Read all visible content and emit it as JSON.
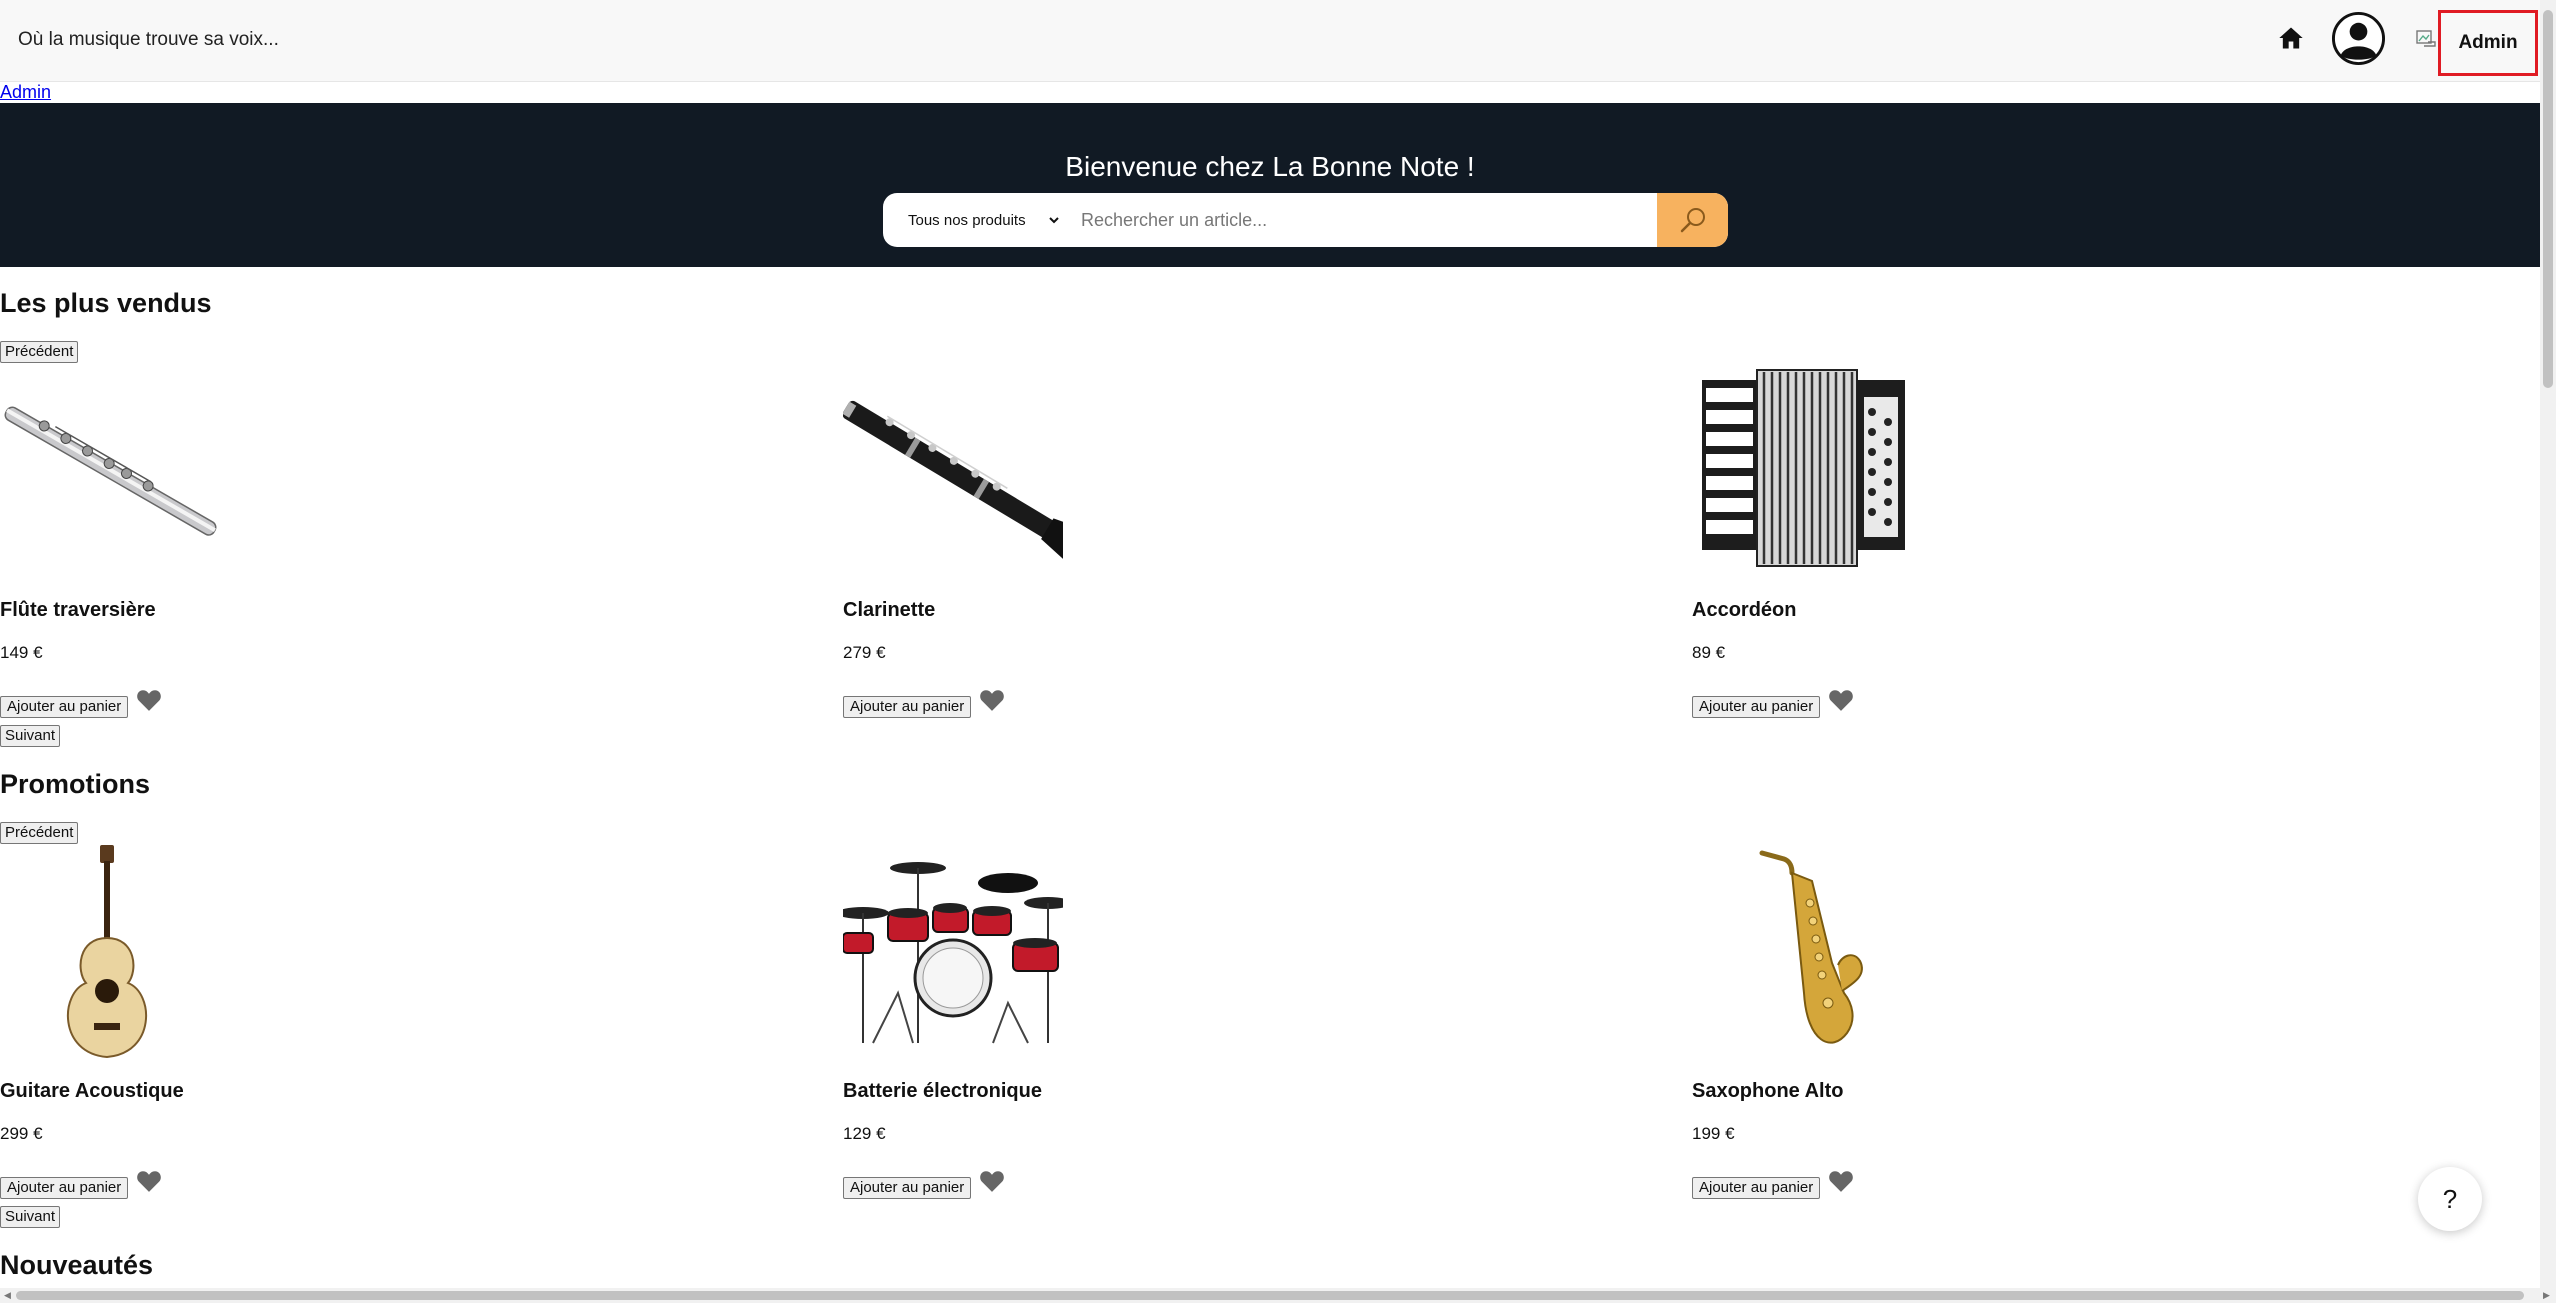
{
  "header": {
    "tagline": "Où la musique trouve sa voix...",
    "icons": [
      "home-icon",
      "user-avatar-icon",
      "broken-image-icon"
    ],
    "admin_label": "Admin"
  },
  "admin_link": "Admin",
  "hero": {
    "title": "Bienvenue chez La Bonne Note !",
    "search": {
      "category": "Tous nos produits",
      "placeholder": "Rechercher un article...",
      "button_icon": "search-icon",
      "button_color": "#f7b25f"
    },
    "background_color": "#111a24"
  },
  "sections": [
    {
      "title": "Les plus vendus",
      "prev_label": "Précédent",
      "next_label": "Suivant",
      "products": [
        {
          "name": "Flûte traversière",
          "price": "149 €",
          "add_label": "Ajouter au panier"
        },
        {
          "name": "Clarinette",
          "price": "279 €",
          "add_label": "Ajouter au panier"
        },
        {
          "name": "Accordéon",
          "price": "89 €",
          "add_label": "Ajouter au panier"
        }
      ]
    },
    {
      "title": "Promotions",
      "prev_label": "Précédent",
      "next_label": "Suivant",
      "products": [
        {
          "name": "Guitare Acoustique",
          "price": "299 €",
          "add_label": "Ajouter au panier"
        },
        {
          "name": "Batterie électronique",
          "price": "129 €",
          "add_label": "Ajouter au panier"
        },
        {
          "name": "Saxophone Alto",
          "price": "199 €",
          "add_label": "Ajouter au panier"
        }
      ]
    },
    {
      "title": "Nouveautés"
    }
  ],
  "help_label": "?"
}
